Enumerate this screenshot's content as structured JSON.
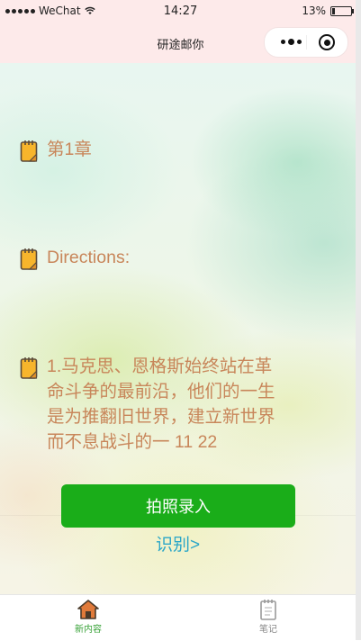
{
  "status_bar": {
    "carrier": "WeChat",
    "time": "14:27",
    "battery": "13%"
  },
  "nav": {
    "title": "研途邮你"
  },
  "items": [
    {
      "text": "第1章"
    },
    {
      "text": "Directions:"
    },
    {
      "text": "1.马克思、恩格斯始终站在革命斗争的最前沿，他们的一生是为推翻旧世界，建立新世界而不息战斗的一 11 22"
    }
  ],
  "actions": {
    "photo_button": "拍照录入",
    "recognize_link": "识别>"
  },
  "tabbar": {
    "tabs": [
      {
        "label": "新内容",
        "icon": "home-icon",
        "active": true
      },
      {
        "label": "笔记",
        "icon": "notepad-icon",
        "active": false
      }
    ]
  },
  "colors": {
    "item_text": "#c8865a",
    "primary_button": "#1aad19",
    "link": "#2aa6c8",
    "active_tab": "#3aa33a"
  }
}
